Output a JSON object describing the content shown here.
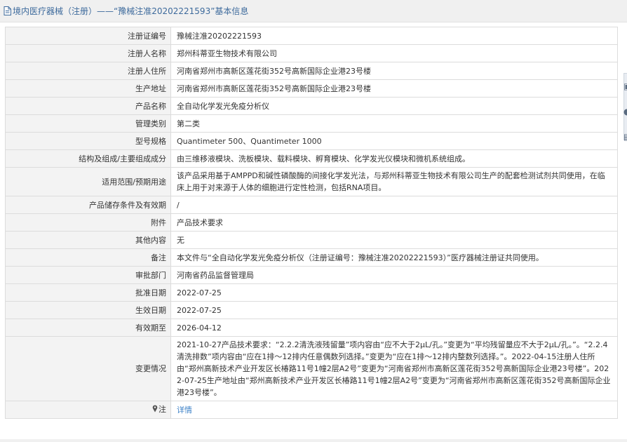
{
  "header": {
    "title": "境内医疗器械（注册）——“豫械注准20202221593”基本信息"
  },
  "rows": [
    {
      "label": "注册证编号",
      "value": "豫械注准20202221593"
    },
    {
      "label": "注册人名称",
      "value": "郑州科蒂亚生物技术有限公司"
    },
    {
      "label": "注册人住所",
      "value": "河南省郑州市高新区莲花街352号高新国际企业港23号楼"
    },
    {
      "label": "生产地址",
      "value": "河南省郑州市高新区莲花街352号高新国际企业港23号楼"
    },
    {
      "label": "产品名称",
      "value": "全自动化学发光免疫分析仪"
    },
    {
      "label": "管理类别",
      "value": "第二类"
    },
    {
      "label": "型号规格",
      "value": "Quantimeter 500、Quantimeter 1000"
    },
    {
      "label": "结构及组成/主要组成成分",
      "value": "由三维移液模块、洗板模块、载料模块、孵育模块、化学发光仪模块和微机系统组成。"
    },
    {
      "label": "适用范围/预期用途",
      "value": "该产品采用基于AMPPD和碱性磷酸酶的间接化学发光法，与郑州科蒂亚生物技术有限公司生产的配套检测试剂共同使用，在临床上用于对来源于人体的细胞进行定性检测，包括RNA项目。"
    },
    {
      "label": "产品储存条件及有效期",
      "value": "/"
    },
    {
      "label": "附件",
      "value": "产品技术要求"
    },
    {
      "label": "其他内容",
      "value": "无"
    },
    {
      "label": "备注",
      "value": "本文件与“全自动化学发光免疫分析仪（注册证编号：豫械注准20202221593）”医疗器械注册证共同使用。"
    },
    {
      "label": "审批部门",
      "value": "河南省药品监督管理局"
    },
    {
      "label": "批准日期",
      "value": "2022-07-25"
    },
    {
      "label": "生效日期",
      "value": "2022-07-25"
    },
    {
      "label": "有效期至",
      "value": "2026-04-12"
    },
    {
      "label": "变更情况",
      "value": "2021-10-27产品技术要求：“2.2.2清洗液残留量”项内容由“应不大于2μL/孔。”变更为“平均残留量应不大于2μL/孔。”。“2.2.4 清洗排数”项内容由“应在1排～12排内任意偶数列选择。”变更为“应在1排～12排内整数列选择。”。2022-04-15注册人住所由“郑州高新技术产业开发区长椿路11号1幢2层A2号”变更为“河南省郑州市高新区莲花街352号高新国际企业港23号楼”。2022-07-25生产地址由“郑州高新技术产业开发区长椿路11号1幢2层A2号”变更为“河南省郑州市高新区莲花街352号高新国际企业港23号楼”。"
    }
  ],
  "note": {
    "label": "注",
    "link_text": "详情",
    "icon": "map-pin-icon"
  },
  "colors": {
    "header_text": "#3d6a9c",
    "label_bg": "#f3f3f3",
    "border": "#dcdcdc",
    "link": "#3b80c7"
  }
}
